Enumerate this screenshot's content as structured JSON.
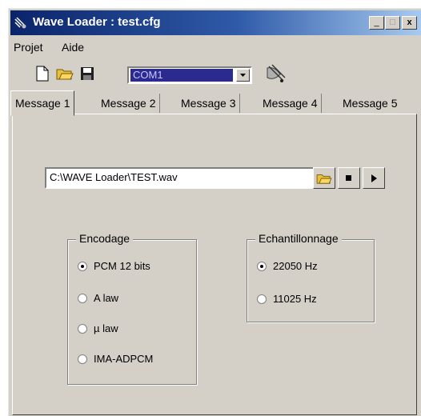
{
  "window": {
    "title": "Wave Loader : test.cfg",
    "min": "_",
    "max": "□",
    "close": "x"
  },
  "menu": {
    "items": [
      "Projet",
      "Aide"
    ]
  },
  "toolbar": {
    "port": "COM1"
  },
  "tabs": [
    "Message 1",
    "Message 2",
    "Message 3",
    "Message 4",
    "Message 5"
  ],
  "active_tab": "Message 1",
  "file": {
    "path": "C:\\WAVE Loader\\TEST.wav"
  },
  "encodage": {
    "label": "Encodage",
    "options": [
      "PCM 12 bits",
      "A law",
      "µ law",
      "IMA-ADPCM"
    ],
    "selected": "PCM 12 bits"
  },
  "echantillonnage": {
    "label": "Echantillonnage",
    "options": [
      "22050 Hz",
      "11025 Hz"
    ],
    "selected": "22050 Hz"
  },
  "colors": {
    "title_start": "#0a246a",
    "title_end": "#a6caf0",
    "combo_bg": "#2b2a8e",
    "face": "#d4d0c8"
  }
}
